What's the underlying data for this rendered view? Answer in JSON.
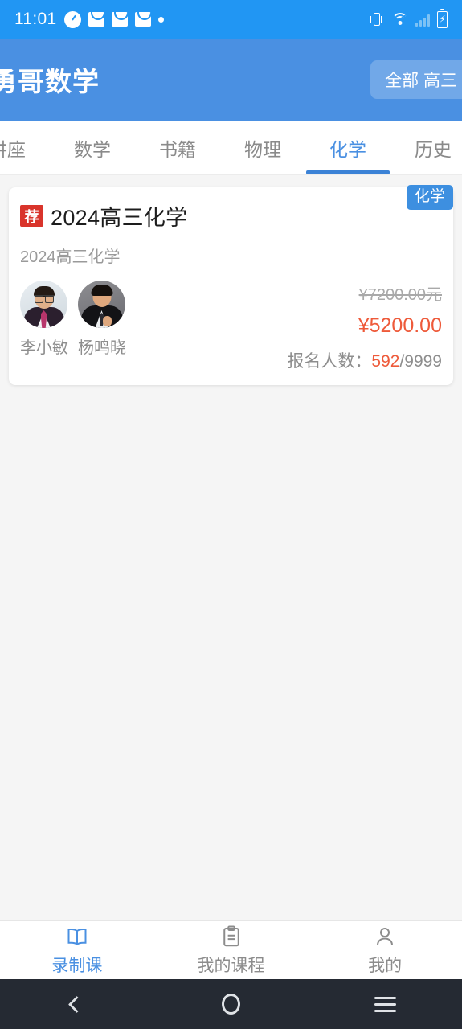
{
  "status_bar": {
    "time": "11:01",
    "icons_left": [
      "clock-icon",
      "mail-icon",
      "mail-icon",
      "mail-icon",
      "dot-icon"
    ],
    "icons_right": [
      "vibrate-icon",
      "wifi-off-icon",
      "signal-icon",
      "battery-charging-icon"
    ]
  },
  "header": {
    "title": "勇哥数学",
    "filter_label": "全部 高三"
  },
  "tabs": [
    {
      "label": "讲座",
      "active": false
    },
    {
      "label": "数学",
      "active": false
    },
    {
      "label": "书籍",
      "active": false
    },
    {
      "label": "物理",
      "active": false
    },
    {
      "label": "化学",
      "active": true
    },
    {
      "label": "历史",
      "active": false
    }
  ],
  "course": {
    "badge": "荐",
    "tag": "化学",
    "title": "2024高三化学",
    "subtitle": "2024高三化学",
    "teachers": [
      {
        "name": "李小敏"
      },
      {
        "name": "杨鸣晓"
      }
    ],
    "price_original": "¥7200.00元",
    "price_current": "¥5200.00",
    "enroll_label": "报名人数：",
    "enroll_count": "592",
    "enroll_total": "/9999"
  },
  "bottom_nav": [
    {
      "label": "录制课",
      "icon": "book-icon",
      "active": true
    },
    {
      "label": "我的课程",
      "icon": "clipboard-icon",
      "active": false
    },
    {
      "label": "我的",
      "icon": "person-icon",
      "active": false
    }
  ],
  "android_nav": {
    "back": "back-icon",
    "home": "home-icon",
    "recents": "recents-icon"
  },
  "colors": {
    "status_bar": "#2196f3",
    "app_bar": "#4a90e2",
    "accent": "#4a90e2",
    "price": "#ee5a3a",
    "badge": "#d9342b",
    "tag": "#3d8fe0"
  }
}
